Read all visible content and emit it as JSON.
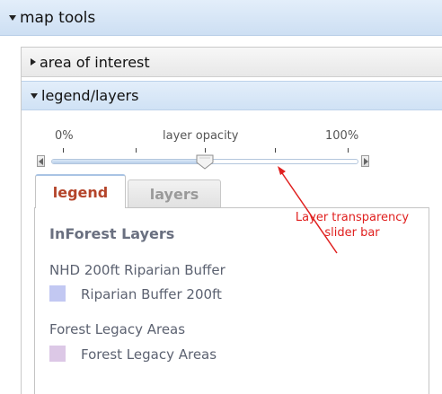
{
  "map_tools": {
    "title": "map tools"
  },
  "sections": {
    "area_of_interest": {
      "label": "area of interest"
    },
    "legend_layers": {
      "label": "legend/layers"
    }
  },
  "opacity_slider": {
    "min_label": "0%",
    "mid_label": "layer opacity",
    "max_label": "100%",
    "value_percent": 50
  },
  "tabs": {
    "legend": {
      "label": "legend",
      "active": true
    },
    "layers": {
      "label": "layers",
      "active": false
    }
  },
  "legend": {
    "title": "InForest Layers",
    "layers": [
      {
        "name": "NHD 200ft Riparian Buffer",
        "swatch_label": "Riparian Buffer 200ft",
        "swatch_color": "#c2c8f2"
      },
      {
        "name": "Forest Legacy Areas",
        "swatch_label": "Forest Legacy Areas",
        "swatch_color": "#dcc8e6"
      }
    ]
  },
  "annotation": {
    "line1": "Layer transparency",
    "line2": "slider bar",
    "color": "#e0201f"
  },
  "colors": {
    "header_blue": "#cddff3",
    "active_tab_text": "#b4442a"
  }
}
